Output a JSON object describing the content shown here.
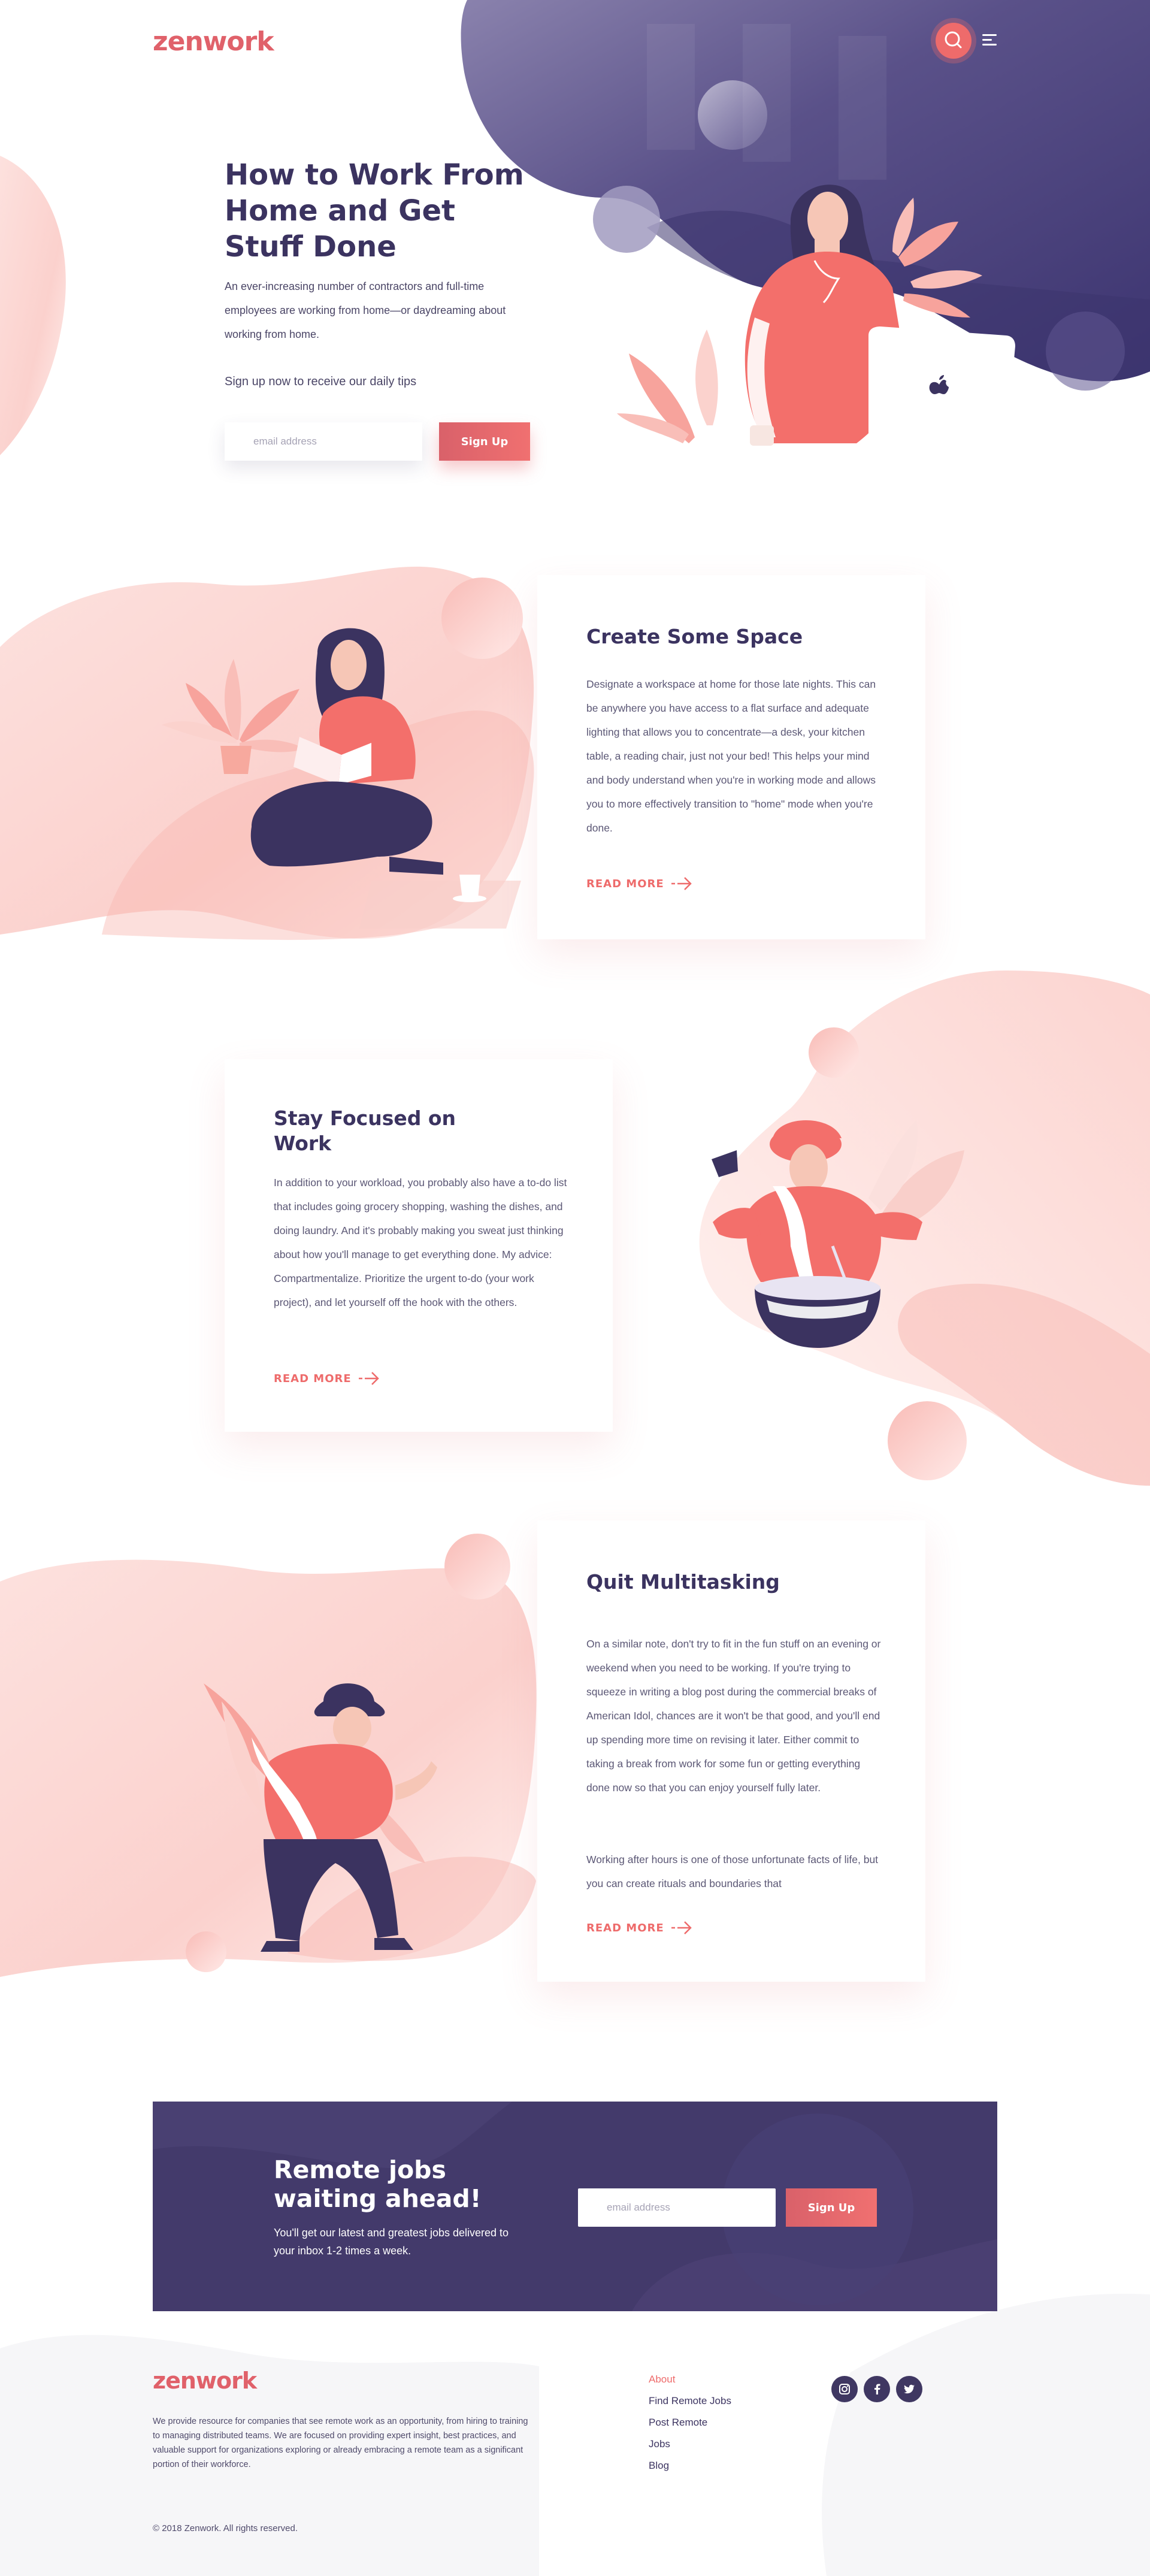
{
  "brand": {
    "logo": "zenwork",
    "accent": "#ee6b6b",
    "dark": "#3b3360"
  },
  "header": {
    "search_icon": "search-icon",
    "menu_icon": "menu-icon"
  },
  "hero": {
    "title": "How to Work From Home and Get Stuff Done",
    "description": "An ever-increasing number of contractors and full-time employees are working from home—or daydreaming about working from home.",
    "signup_prompt": "Sign up now to receive our daily tips",
    "email_placeholder": "email address",
    "signup_label": "Sign Up"
  },
  "sections": [
    {
      "title": "Create Some Space",
      "body": "Designate a workspace at home for those late nights. This can be anywhere you have access to a flat surface and adequate lighting that allows you to concentrate—a desk, your kitchen table, a reading chair, just not your bed! This helps your mind and body understand when you're in working mode and allows you to more effectively transition to \"home\" mode when you're done.",
      "read_more": "READ MORE"
    },
    {
      "title": "Stay Focused on Work",
      "body": "In addition to your workload, you probably also have a to-do list that includes going grocery shopping, washing the dishes, and doing laundry. And it's probably making you sweat just thinking about how you'll manage to get everything done. My advice: Compartmentalize. Prioritize the urgent to-do (your work project), and let yourself off the hook with the others.",
      "read_more": "READ MORE"
    },
    {
      "title": "Quit Multitasking",
      "body": "On a similar note, don't try to fit in the fun stuff on an evening or weekend when you need to be working. If you're trying to squeeze in writing a blog post during the commercial breaks of American Idol, chances are it won't be that good, and you'll end up spending more time on revising it later. Either commit to taking a break from work for some fun or getting everything done now so that you can enjoy yourself fully later.",
      "body2": "Working after hours is one of those unfortunate facts of life, but you can create rituals and boundaries that",
      "read_more": "READ MORE"
    }
  ],
  "cta": {
    "title": "Remote jobs waiting ahead!",
    "subtitle": "You'll get our latest and greatest jobs delivered to your inbox 1-2 times a week.",
    "email_placeholder": "email address",
    "signup_label": "Sign Up"
  },
  "footer": {
    "logo": "zenwork",
    "description": "We provide resource for companies that see remote work as an opportunity, from hiring to training to managing distributed teams. We are focused on providing expert insight, best practices, and valuable support for organizations exploring or already embracing a remote team as a significant portion of their workforce.",
    "links": [
      "About",
      "Find Remote Jobs",
      "Post Remote",
      "Jobs",
      "Blog"
    ],
    "social": [
      "instagram-icon",
      "facebook-icon",
      "twitter-icon"
    ],
    "copyright": "© 2018 Zenwork. All rights reserved."
  }
}
